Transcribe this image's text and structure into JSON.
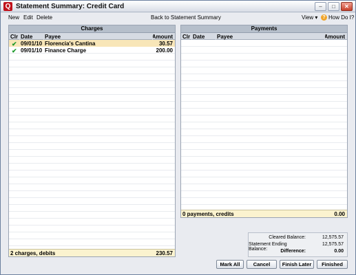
{
  "window": {
    "title": "Statement Summary: Credit Card",
    "app_icon": "Q",
    "minimize": "–",
    "maximize": "□",
    "close": "✕"
  },
  "menu": {
    "new": "New",
    "edit": "Edit",
    "delete": "Delete",
    "back": "Back to Statement Summary",
    "view": "View ▾",
    "help_icon": "?",
    "how_do_i": "How Do I?"
  },
  "charges": {
    "title": "Charges",
    "columns": {
      "clr": "Clr",
      "date": "Date",
      "payee": "Payee",
      "amount": "Amount"
    },
    "rows": [
      {
        "cleared": "✔",
        "date": "09/01/10",
        "payee": "Florencia's Cantina",
        "amount": "30.57"
      },
      {
        "cleared": "✔",
        "date": "09/01/10",
        "payee": "Finance Charge",
        "amount": "200.00"
      }
    ],
    "footer_label": "2 charges, debits",
    "footer_total": "230.57"
  },
  "payments": {
    "title": "Payments",
    "columns": {
      "clr": "Clr",
      "date": "Date",
      "payee": "Payee",
      "amount": "Amount"
    },
    "footer_label": "0 payments, credits",
    "footer_total": "0.00"
  },
  "summary": {
    "cleared_label": "Cleared Balance:",
    "cleared_value": "12,575.57",
    "ending_label": "Statement Ending Balance:",
    "ending_value": "12,575.57",
    "difference_label": "Difference:",
    "difference_value": "0.00"
  },
  "buttons": {
    "mark_all": "Mark All",
    "cancel": "Cancel",
    "finish_later": "Finish Later",
    "finished": "Finished"
  }
}
